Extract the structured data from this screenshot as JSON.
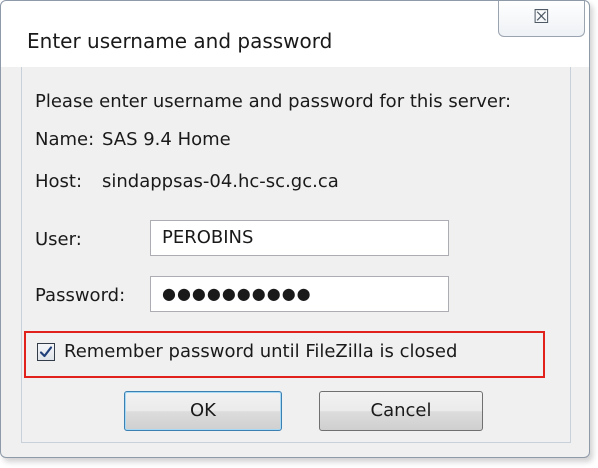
{
  "dialog": {
    "title": "Enter username and password",
    "close_glyph": "☒",
    "prompt": "Please enter username and password for this server:",
    "name_label": "Name:",
    "name_value": "SAS 9.4 Home",
    "host_label": "Host:",
    "host_value": "sindappsas-04.hc-sc.gc.ca",
    "user_label": "User:",
    "user_value": "PEROBINS",
    "password_label": "Password:",
    "password_value": "●●●●●●●●●●",
    "remember_label": "Remember password until FileZilla is closed",
    "remember_checked": true,
    "ok_label": "OK",
    "cancel_label": "Cancel"
  },
  "colors": {
    "highlight": "#e0211c",
    "background": "#f0f0f0",
    "checkmark": "#1f3f7a"
  }
}
